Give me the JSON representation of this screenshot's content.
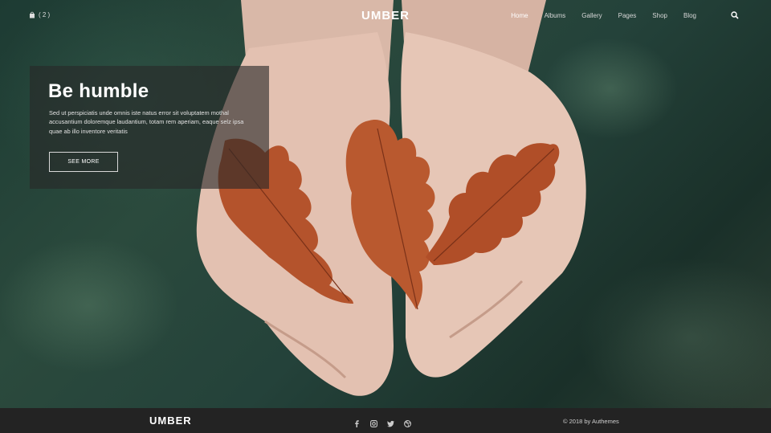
{
  "header": {
    "cart_count": "( 2 )",
    "logo": "UMBER",
    "nav": [
      {
        "label": "Home",
        "active": true
      },
      {
        "label": "Albums",
        "active": false
      },
      {
        "label": "Gallery",
        "active": false
      },
      {
        "label": "Pages",
        "active": false
      },
      {
        "label": "Shop",
        "active": false
      },
      {
        "label": "Blog",
        "active": false
      }
    ],
    "search_icon": "search-icon",
    "cart_icon": "shopping-bag-icon"
  },
  "hero": {
    "title": "Be humble",
    "text": "Sed ut perspiciatis unde omnis iste natus error sit voluptatem  mothal accusantium doloremque laudantium, totam rem aperiam, eaque selz ipsa quae ab illo inventore veritatis",
    "button_label": "SEE MORE"
  },
  "footer": {
    "logo": "UMBER",
    "social_icons": [
      "facebook-icon",
      "instagram-icon",
      "twitter-icon",
      "dribbble-icon"
    ],
    "copyright": "© 2018 by Authemes"
  },
  "colors": {
    "footer_bg": "#232323",
    "overlay": "#282828",
    "leaf": "#b4532c",
    "foliage": "#24423a"
  }
}
